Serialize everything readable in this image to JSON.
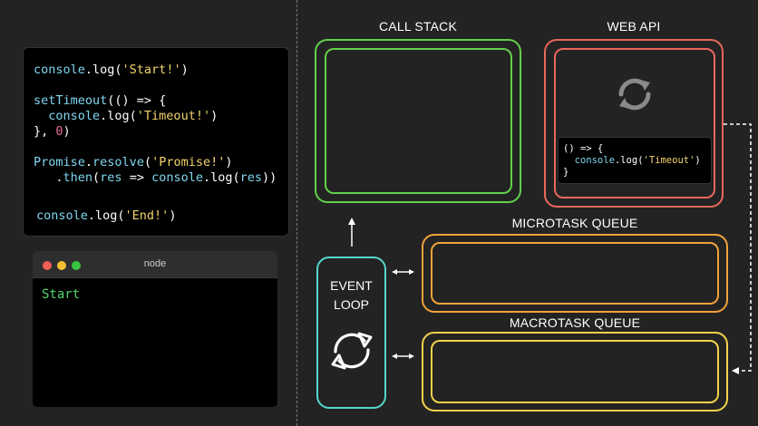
{
  "code_panel": {
    "lines": [
      [
        {
          "t": "console",
          "c": "ident"
        },
        {
          "t": ".log(",
          "c": "punc"
        },
        {
          "t": "'Start!'",
          "c": "str"
        },
        {
          "t": ")",
          "c": "punc"
        }
      ],
      [],
      [
        {
          "t": "setTimeout",
          "c": "ident"
        },
        {
          "t": "(() => {",
          "c": "punc"
        }
      ],
      [
        {
          "t": "  console",
          "c": "ident"
        },
        {
          "t": ".log(",
          "c": "punc"
        },
        {
          "t": "'Timeout!'",
          "c": "str"
        },
        {
          "t": ")",
          "c": "punc"
        }
      ],
      [
        {
          "t": "}, ",
          "c": "punc"
        },
        {
          "t": "0",
          "c": "num"
        },
        {
          "t": ")",
          "c": "punc"
        }
      ],
      [],
      [
        {
          "t": "Promise",
          "c": "ident"
        },
        {
          "t": ".",
          "c": "punc"
        },
        {
          "t": "resolve",
          "c": "ident"
        },
        {
          "t": "(",
          "c": "punc"
        },
        {
          "t": "'Promise!'",
          "c": "str"
        },
        {
          "t": ")",
          "c": "punc"
        }
      ],
      [
        {
          "t": "   .",
          "c": "punc"
        },
        {
          "t": "then",
          "c": "ident"
        },
        {
          "t": "(",
          "c": "punc"
        },
        {
          "t": "res",
          "c": "ident"
        },
        {
          "t": " => ",
          "c": "punc"
        },
        {
          "t": "console",
          "c": "ident"
        },
        {
          "t": ".log(",
          "c": "punc"
        },
        {
          "t": "res",
          "c": "ident"
        },
        {
          "t": "))",
          "c": "punc"
        }
      ],
      [],
      [
        {
          "t": "console",
          "c": "ident"
        },
        {
          "t": ".log(",
          "c": "punc"
        },
        {
          "t": "'End!'",
          "c": "str"
        },
        {
          "t": ")",
          "c": "punc"
        }
      ]
    ]
  },
  "terminal": {
    "title": "node",
    "output": "Start",
    "dot_colors": [
      "#ee5f57",
      "#f5bd31",
      "#39c53f"
    ]
  },
  "call_stack": {
    "title": "CALL STACK"
  },
  "web_api": {
    "title": "WEB API",
    "code_lines": [
      [
        {
          "t": "() => {",
          "c": "punc"
        }
      ],
      [
        {
          "t": "  console",
          "c": "ident"
        },
        {
          "t": ".log(",
          "c": "punc"
        },
        {
          "t": "'Timeout'",
          "c": "str"
        },
        {
          "t": ")",
          "c": "punc"
        }
      ],
      [
        {
          "t": "}",
          "c": "punc"
        }
      ]
    ]
  },
  "microtask_queue": {
    "title": "MICROTASK QUEUE"
  },
  "macrotask_queue": {
    "title": "MACROTASK QUEUE"
  },
  "event_loop": {
    "line1": "EVENT",
    "line2": "LOOP"
  },
  "icons": {
    "web_api_icon": "refresh-icon",
    "event_loop_icon": "refresh-icon"
  },
  "colors": {
    "call_stack": "#62d04a",
    "web_api": "#e8685a",
    "microtask_queue": "#f2a23a",
    "macrotask_queue": "#f4d24a",
    "event_loop": "#56d6cc"
  }
}
